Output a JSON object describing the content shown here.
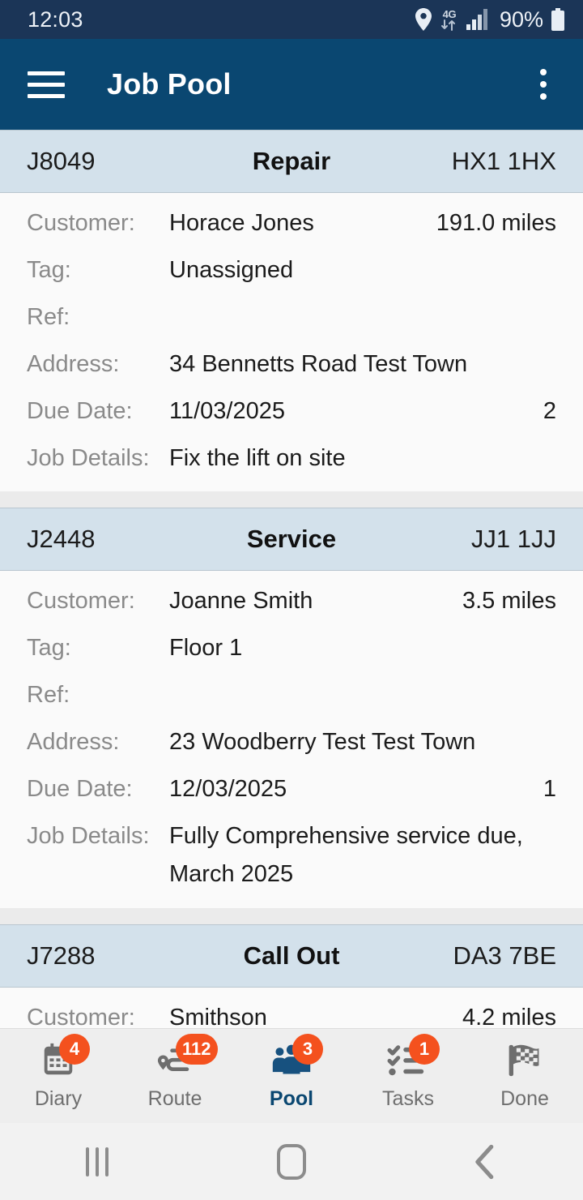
{
  "status_bar": {
    "clock": "12:03",
    "battery_percent": "90%",
    "network_type": "4G",
    "icons": [
      "location-pin-icon",
      "mobile-data-icon",
      "signal-bars-icon",
      "battery-icon"
    ]
  },
  "app_bar": {
    "menu_icon": "hamburger-menu-icon",
    "title": "Job Pool",
    "overflow_icon": "more-vertical-icon",
    "background_color": "#0a4771"
  },
  "theme": {
    "status_bar_color": "#1b3557",
    "card_header_color": "#d3e1eb",
    "accent_color": "#0a4771",
    "badge_color": "#f4511e",
    "label_color": "#8a8a8a"
  },
  "labels": {
    "customer": "Customer:",
    "tag": "Tag:",
    "ref": "Ref:",
    "address": "Address:",
    "due_date": "Due Date:",
    "job_details": "Job Details:"
  },
  "jobs": [
    {
      "id": "J8049",
      "type": "Repair",
      "postcode": "HX1 1HX",
      "customer": "Horace Jones",
      "distance": "191.0 miles",
      "tag": "Unassigned",
      "ref": "",
      "address": "34 Bennetts Road Test Town",
      "due_date": "11/03/2025",
      "due_count": "2",
      "job_details": "Fix the lift on site"
    },
    {
      "id": "J2448",
      "type": "Service",
      "postcode": "JJ1 1JJ",
      "customer": "Joanne Smith",
      "distance": "3.5 miles",
      "tag": "Floor 1",
      "ref": "",
      "address": "23 Woodberry Test Test Town",
      "due_date": "12/03/2025",
      "due_count": "1",
      "job_details": "Fully Comprehensive service due, March 2025"
    },
    {
      "id": "J7288",
      "type": "Call Out",
      "postcode": "DA3 7BE",
      "customer": "Smithson",
      "distance": "4.2 miles",
      "tag": "",
      "ref": "",
      "address": "",
      "due_date": "",
      "due_count": "",
      "job_details": ""
    }
  ],
  "bottom_nav": [
    {
      "label": "Diary",
      "icon": "calendar-icon",
      "badge": "4",
      "active": false
    },
    {
      "label": "Route",
      "icon": "route-pin-icon",
      "badge": "112",
      "active": false
    },
    {
      "label": "Pool",
      "icon": "people-group-icon",
      "badge": "3",
      "active": true
    },
    {
      "label": "Tasks",
      "icon": "checklist-icon",
      "badge": "1",
      "active": false
    },
    {
      "label": "Done",
      "icon": "checkered-flag-icon",
      "badge": "",
      "active": false
    }
  ],
  "system_nav": {
    "recents": "recents-icon",
    "home": "home-icon",
    "back": "back-icon"
  }
}
